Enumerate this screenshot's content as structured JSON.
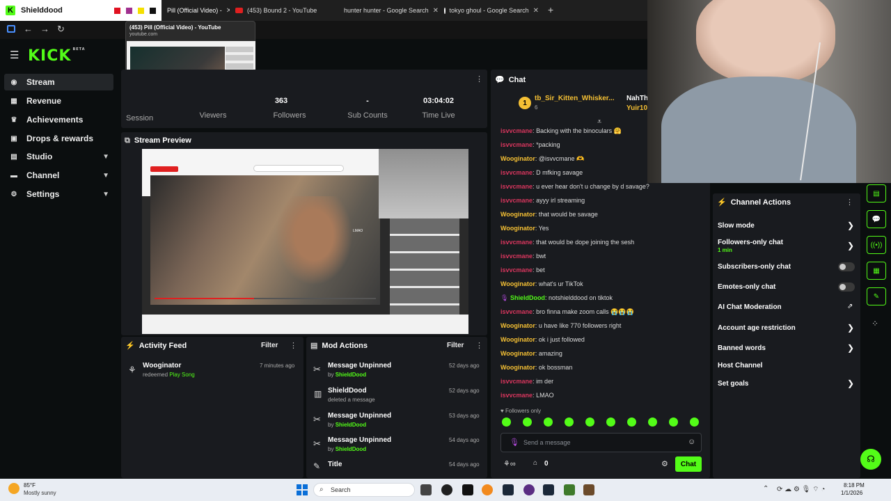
{
  "browser": {
    "active_tab": "Shielddood",
    "tabs": [
      {
        "label": "Pill (Official Video) -"
      },
      {
        "label": "(453) Bound 2 - YouTube"
      },
      {
        "label": "hunter hunter - Google Search"
      },
      {
        "label": "tokyo ghoul - Google Search"
      }
    ],
    "tooltip_title": "(453) Pill (Official Video) - YouTube",
    "tooltip_url": "youtube.com"
  },
  "sidebar": {
    "logo": "KICK",
    "logo_badge": "BETA",
    "items": [
      {
        "label": "Stream",
        "icon": "stream-icon"
      },
      {
        "label": "Revenue",
        "icon": "revenue-icon"
      },
      {
        "label": "Achievements",
        "icon": "trophy-icon"
      },
      {
        "label": "Drops & rewards",
        "icon": "gift-icon"
      },
      {
        "label": "Studio",
        "icon": "studio-icon"
      },
      {
        "label": "Channel",
        "icon": "channel-icon"
      },
      {
        "label": "Settings",
        "icon": "gear-icon"
      }
    ]
  },
  "stats": {
    "session_label": "Session",
    "viewers_label": "Viewers",
    "followers_value": "363",
    "followers_label": "Followers",
    "subs_value": "-",
    "subs_label": "Sub Counts",
    "time_value": "03:04:02",
    "time_label": "Time Live"
  },
  "preview": {
    "title": "Stream Preview",
    "overlay_text": "LMAO"
  },
  "activity_feed": {
    "title": "Activity Feed",
    "filter": "Filter",
    "items": [
      {
        "user": "Wooginator",
        "action": "redeemed",
        "reward": "Play Song",
        "time": "7 minutes ago"
      }
    ]
  },
  "mod_actions": {
    "title": "Mod Actions",
    "filter": "Filter",
    "items": [
      {
        "title": "Message Unpinned",
        "by_prefix": "by",
        "by": "ShieldDood",
        "time": "52 days ago"
      },
      {
        "title": "ShieldDood",
        "detail": "deleted a message",
        "time": "52 days ago"
      },
      {
        "title": "Message Unpinned",
        "by_prefix": "by",
        "by": "ShieldDood",
        "time": "53 days ago"
      },
      {
        "title": "Message Unpinned",
        "by_prefix": "by",
        "by": "ShieldDood",
        "time": "54 days ago"
      },
      {
        "title": "Title",
        "time": "54 days ago"
      }
    ]
  },
  "chat": {
    "title": "Chat",
    "top_user": "tb_Sir_Kitten_Whisker...",
    "top_user_count": "6",
    "top_user2": "NahTh",
    "top_user3": "Yuir10",
    "rank": "1",
    "messages": [
      {
        "user": "isvvcmane",
        "text": "Backing with the binoculars 🤗",
        "color": "#d9365e"
      },
      {
        "user": "isvvcmane",
        "text": "*packing",
        "color": "#d9365e"
      },
      {
        "user": "Wooginator",
        "text": "@isvvcmane 🫶",
        "color": "#f5c034"
      },
      {
        "user": "isvvcmane",
        "text": "D mfking savage",
        "color": "#d9365e"
      },
      {
        "user": "isvvcmane",
        "text": "u ever hear don't u change by d savage?",
        "color": "#d9365e"
      },
      {
        "user": "isvvcmane",
        "text": "ayyy irl streaming",
        "color": "#d9365e"
      },
      {
        "user": "Wooginator",
        "text": "that would be savage",
        "color": "#f5c034"
      },
      {
        "user": "Wooginator",
        "text": "Yes",
        "color": "#f5c034"
      },
      {
        "user": "isvvcmane",
        "text": "that would be dope joining the sesh",
        "color": "#d9365e"
      },
      {
        "user": "isvvcmane",
        "text": "bwt",
        "color": "#d9365e"
      },
      {
        "user": "isvvcmane",
        "text": "bet",
        "color": "#d9365e"
      },
      {
        "user": "Wooginator",
        "text": "what's ur TikTok",
        "color": "#f5c034"
      },
      {
        "user": "ShieldDood",
        "text": "notshielddood on tiktok",
        "color": "#53fc18"
      },
      {
        "user": "isvvcmane",
        "text": "bro finna make zoom calls 😭😭😭",
        "color": "#d9365e"
      },
      {
        "user": "Wooginator",
        "text": "u have like 770 followers right",
        "color": "#f5c034"
      },
      {
        "user": "Wooginator",
        "text": "ok i just followed",
        "color": "#f5c034"
      },
      {
        "user": "Wooginator",
        "text": "amazing",
        "color": "#f5c034"
      },
      {
        "user": "Wooginator",
        "text": "ok bossman",
        "color": "#f5c034"
      },
      {
        "user": "isvvcmane",
        "text": "im der",
        "color": "#d9365e"
      },
      {
        "user": "isvvcmane",
        "text": "LMAO",
        "color": "#d9365e"
      }
    ],
    "followers_only": "Followers only",
    "input_placeholder": "Send a message",
    "points": "0",
    "send_label": "Chat"
  },
  "channel_actions": {
    "title": "Channel Actions",
    "items": [
      {
        "label": "Slow mode"
      },
      {
        "label": "Followers-only chat",
        "sub": "1 min"
      },
      {
        "label": "Subscribers-only chat"
      },
      {
        "label": "Emotes-only chat"
      },
      {
        "label": "AI Chat Moderation"
      },
      {
        "label": "Account age restriction"
      },
      {
        "label": "Banned words"
      },
      {
        "label": "Host Channel"
      },
      {
        "label": "Set goals"
      }
    ]
  },
  "taskbar": {
    "weather_temp": "85°F",
    "weather_desc": "Mostly sunny",
    "search_label": "Search",
    "time": "8:18 PM",
    "date": "1/1/2026"
  },
  "colors": {
    "accent": "#53fc18",
    "panel": "#191b1f",
    "bg": "#0b0e0f"
  }
}
